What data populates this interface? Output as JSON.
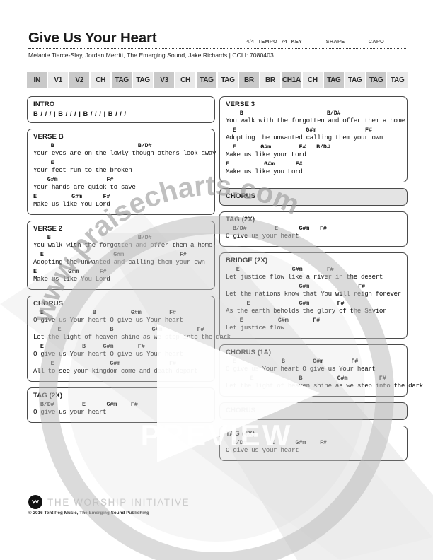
{
  "header": {
    "title": "Give Us Your Heart",
    "time_signature": "4/4",
    "tempo_label": "TEMPO",
    "tempo_value": "74",
    "key_label": "KEY",
    "shape_label": "SHAPE",
    "capo_label": "CAPO",
    "byline": "Melanie Tierce-Slay, Jordan Merritt, The Emerging Sound, Jake Richards | CCLI: 7080403"
  },
  "nav_tags": [
    {
      "label": "IN",
      "shade": "dark"
    },
    {
      "label": "V1",
      "shade": "light"
    },
    {
      "label": "V2",
      "shade": "dark"
    },
    {
      "label": "CH",
      "shade": "light"
    },
    {
      "label": "TAG",
      "shade": "dark"
    },
    {
      "label": "TAG",
      "shade": "light"
    },
    {
      "label": "V3",
      "shade": "dark"
    },
    {
      "label": "CH",
      "shade": "light"
    },
    {
      "label": "TAG",
      "shade": "dark"
    },
    {
      "label": "TAG",
      "shade": "light"
    },
    {
      "label": "BR",
      "shade": "dark"
    },
    {
      "label": "BR",
      "shade": "light"
    },
    {
      "label": "CH1A",
      "shade": "dark"
    },
    {
      "label": "CH",
      "shade": "light"
    },
    {
      "label": "TAG",
      "shade": "dark"
    },
    {
      "label": "TAG",
      "shade": "light"
    },
    {
      "label": "TAG",
      "shade": "dark"
    },
    {
      "label": "TAG",
      "shade": "light"
    }
  ],
  "left_column": {
    "intro": {
      "label": "INTRO",
      "chords": "B / / / | B / / / | B / / / | B / / /"
    },
    "verse_b": {
      "label": "VERSE B",
      "lines": [
        {
          "chords": "     B                        B/D#",
          "lyric": "Your eyes are on the lowly though others look away"
        },
        {
          "chords": "     E",
          "lyric": "Your feet run to the broken"
        },
        {
          "chords": "    G#m              F#",
          "lyric": "Your hands are quick to save"
        },
        {
          "chords": "E          G#m      F#",
          "lyric": "Make us like You Lord"
        }
      ]
    },
    "verse_2": {
      "label": "VERSE 2",
      "lines": [
        {
          "chords": "    B                         B/D#",
          "lyric": "You walk with the forgotten and offer them a home"
        },
        {
          "chords": "  E                    G#m                F#",
          "lyric": "Adopting the unwanted and calling them your own"
        },
        {
          "chords": "E         G#m      F#",
          "lyric": "Make us like You Lord"
        }
      ]
    },
    "chorus": {
      "label": "CHORUS",
      "lines": [
        {
          "chords": "  E              B          G#m        F#",
          "lyric": "O give us Your heart O give us Your heart"
        },
        {
          "chords": "       E              B           G#m          F#",
          "lyric": "Let the light of heaven shine as we step into the dark"
        },
        {
          "chords": "  E           B     G#m       F#",
          "lyric": "O give us Your heart O give us Your heart"
        },
        {
          "chords": "     E                G#m              F#",
          "lyric": "All to see your kingdom come and death depart"
        }
      ]
    },
    "tag_2x": {
      "label": "TAG (2X)",
      "lines": [
        {
          "chords": "  B/D#        E      G#m    F#",
          "lyric": "O give us your heart"
        }
      ]
    }
  },
  "right_column": {
    "verse_3": {
      "label": "VERSE 3",
      "lines": [
        {
          "chords": "    B                        B/D#",
          "lyric": "You walk with the forgotten and offer them a home"
        },
        {
          "chords": "  E                    G#m              F#",
          "lyric": "Adopting the unwanted calling them your own"
        },
        {
          "chords": "  E       G#m        F#   B/D#",
          "lyric": "Make us like your Lord"
        },
        {
          "chords": "E          G#m      F#",
          "lyric": "Make us like you Lord"
        }
      ]
    },
    "chorus_bar_1": {
      "label": "CHORUS"
    },
    "tag_2x": {
      "label": "TAG (2X)",
      "lines": [
        {
          "chords": "  B/D#        E      G#m   F#",
          "lyric": "O give us your heart"
        }
      ]
    },
    "bridge_2x": {
      "label": "BRIDGE (2X)",
      "lines": [
        {
          "chords": "   E               G#m       F#",
          "lyric": "Let justice flow like a river in the desert"
        },
        {
          "chords": "                     G#m              F#",
          "lyric": "Let the nations know that You will reign forever"
        },
        {
          "chords": "      E              G#m        F#",
          "lyric": "As the earth beholds the glory of the Savior"
        },
        {
          "chords": "    E          G#m       F#",
          "lyric": "Let justice flow"
        }
      ]
    },
    "chorus_1a": {
      "label": "CHORUS (1A)",
      "lines": [
        {
          "chords": "  E             B        G#m        F#",
          "lyric": "O give us Your heart O give us Your heart"
        },
        {
          "chords": "       E             B          G#m         F#",
          "lyric": "Let the light of heaven shine as we step into the dark"
        }
      ]
    },
    "chorus_bar_2": {
      "label": "CHORUS"
    },
    "tag_4x": {
      "label": "TAG (4X)",
      "lines": [
        {
          "chords": "  B/D#       E      G#m    F#",
          "lyric": "O give us your heart"
        }
      ]
    }
  },
  "footer": {
    "brand": "THE WORSHIP INITIATIVE",
    "copyright": "© 2016 Tent Peg Music, The Emerging Sound Publishing"
  },
  "watermark": {
    "arc_text": "www.praisecharts.com",
    "preview_text": "PREVIEW"
  }
}
